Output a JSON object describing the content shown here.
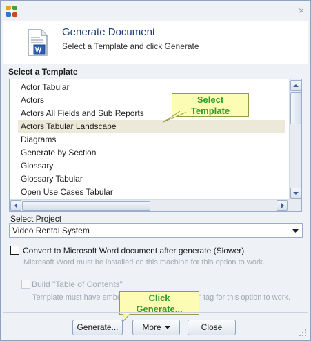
{
  "window": {
    "close_glyph": "×"
  },
  "header": {
    "title": "Generate Document",
    "subtitle": "Select a Template and click Generate",
    "icon": "word-document-icon"
  },
  "templates": {
    "label": "Select a Template",
    "items": [
      "Actor Tabular",
      "Actors",
      "Actors All Fields and Sub Reports",
      "Actors Tabular Landscape",
      "Diagrams",
      "Generate by Section",
      "Glossary",
      "Glossary Tabular",
      "Open Use Cases Tabular"
    ],
    "selected": "Actors Tabular Landscape"
  },
  "project": {
    "label": "Select Project",
    "value": "Video Rental System"
  },
  "convert_word": {
    "label": "Convert to Microsoft Word document after generate (Slower)",
    "hint": "Microsoft Word must be installed on this machine for this option to work.",
    "checked": false
  },
  "toc": {
    "label": "Build  \"Table of Contents\"",
    "hint_left": "Template must have embe",
    "hint_right": "\" tag for this option to work.",
    "checked": false,
    "enabled": false
  },
  "callouts": {
    "select_template_line1": "Select",
    "select_template_line2": "Template",
    "click_generate_line1": "Click",
    "click_generate_line2": "Generate..."
  },
  "buttons": {
    "generate": "Generate...",
    "more": "More",
    "close": "Close"
  },
  "colors": {
    "accent_title": "#1e3f7a",
    "callout_bg": "#fcfcb4",
    "callout_text": "#2c9d2c",
    "selection_bg": "#ece9d8"
  }
}
